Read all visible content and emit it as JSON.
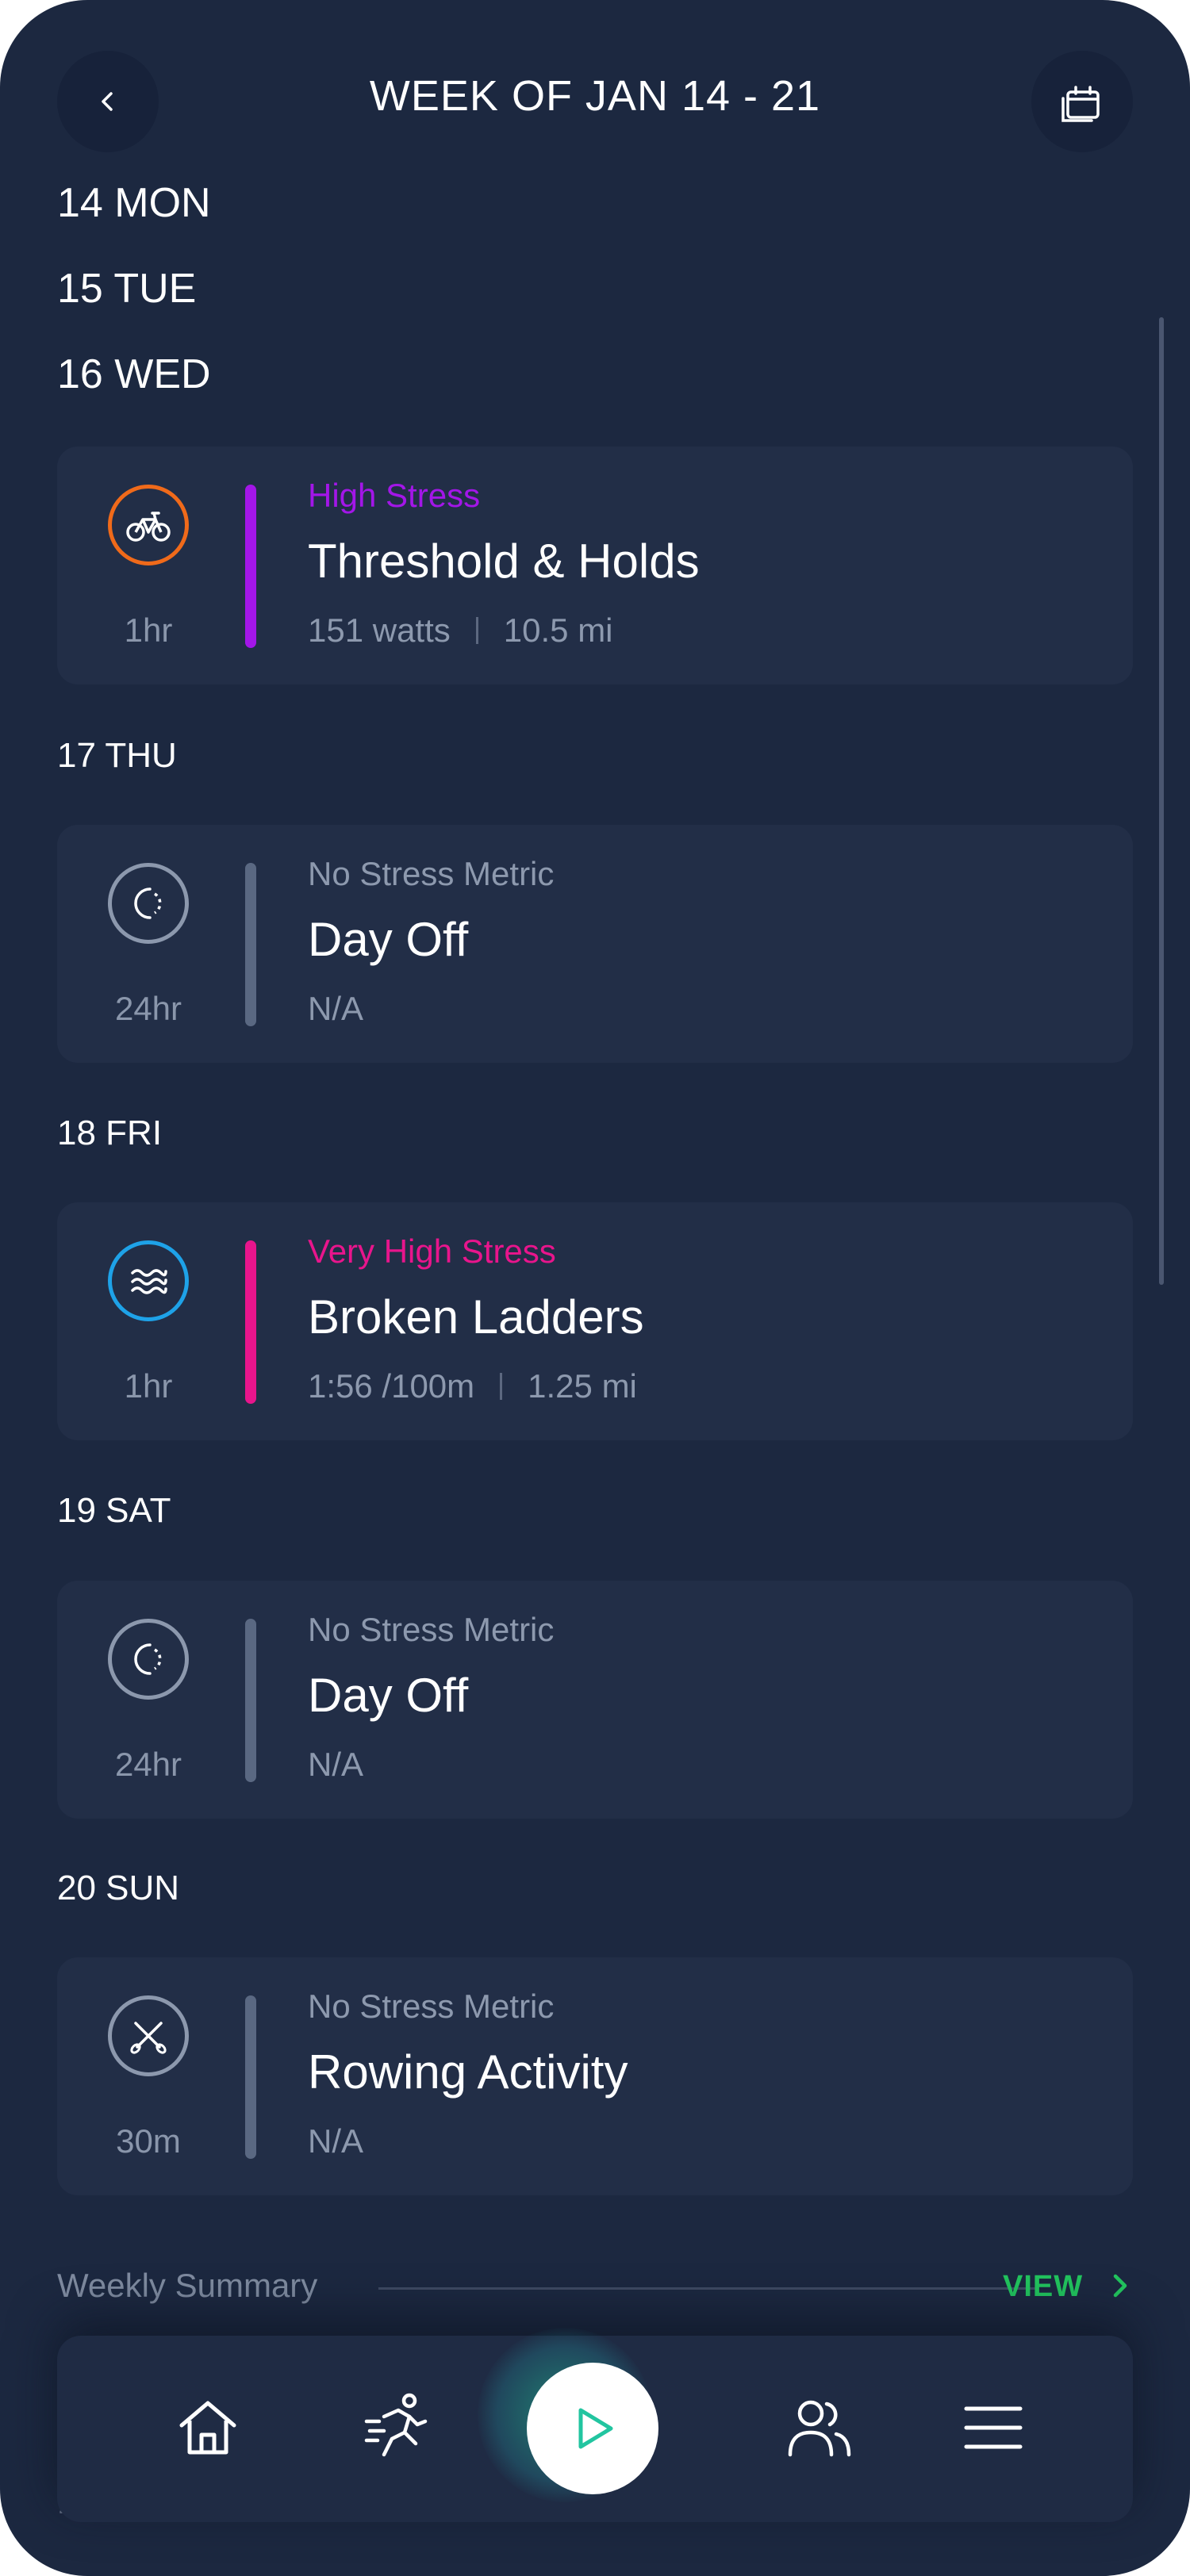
{
  "header": {
    "title": "WEEK OF JAN 14 - 21",
    "back_icon": "chevron-left-icon",
    "calendar_icon": "calendar-stack-icon"
  },
  "days": {
    "mon": "14 MON",
    "tue": "15 TUE",
    "wed": "16 WED",
    "thu": "17 THU",
    "fri": "18 FRI",
    "sat": "19 SAT",
    "sun": "20 SUN"
  },
  "workouts": [
    {
      "icon": "bike-icon",
      "duration": "1hr",
      "stress": "High Stress",
      "stress_color": "#a316e8",
      "name": "Threshold & Holds",
      "metric1": "151 watts",
      "metric2": "10.5 mi"
    },
    {
      "icon": "moon-icon",
      "duration": "24hr",
      "stress": "No Stress Metric",
      "stress_color": "#5a6882",
      "name": "Day Off",
      "metric1": "N/A"
    },
    {
      "icon": "swim-icon",
      "duration": "1hr",
      "stress": "Very High Stress",
      "stress_color": "#e8158c",
      "name": "Broken Ladders",
      "metric1": "1:56 /100m",
      "metric2": "1.25 mi"
    },
    {
      "icon": "moon-icon",
      "duration": "24hr",
      "stress": "No Stress Metric",
      "stress_color": "#5a6882",
      "name": "Day Off",
      "metric1": "N/A"
    },
    {
      "icon": "rowing-icon",
      "duration": "30m",
      "stress": "No Stress Metric",
      "stress_color": "#5a6882",
      "name": "Rowing Activity",
      "metric1": "N/A"
    }
  ],
  "summary": {
    "label": "Weekly Summary",
    "view": "VIEW"
  },
  "ghost_text": "14",
  "nav": {
    "items": [
      "home-icon",
      "activity-icon",
      "play-icon",
      "community-icon",
      "menu-icon"
    ],
    "accent": "#22c55e"
  },
  "colors": {
    "background": "#1c2840",
    "card": "#222e47",
    "bike": "#f06a1a",
    "swim": "#1ea2e8"
  }
}
